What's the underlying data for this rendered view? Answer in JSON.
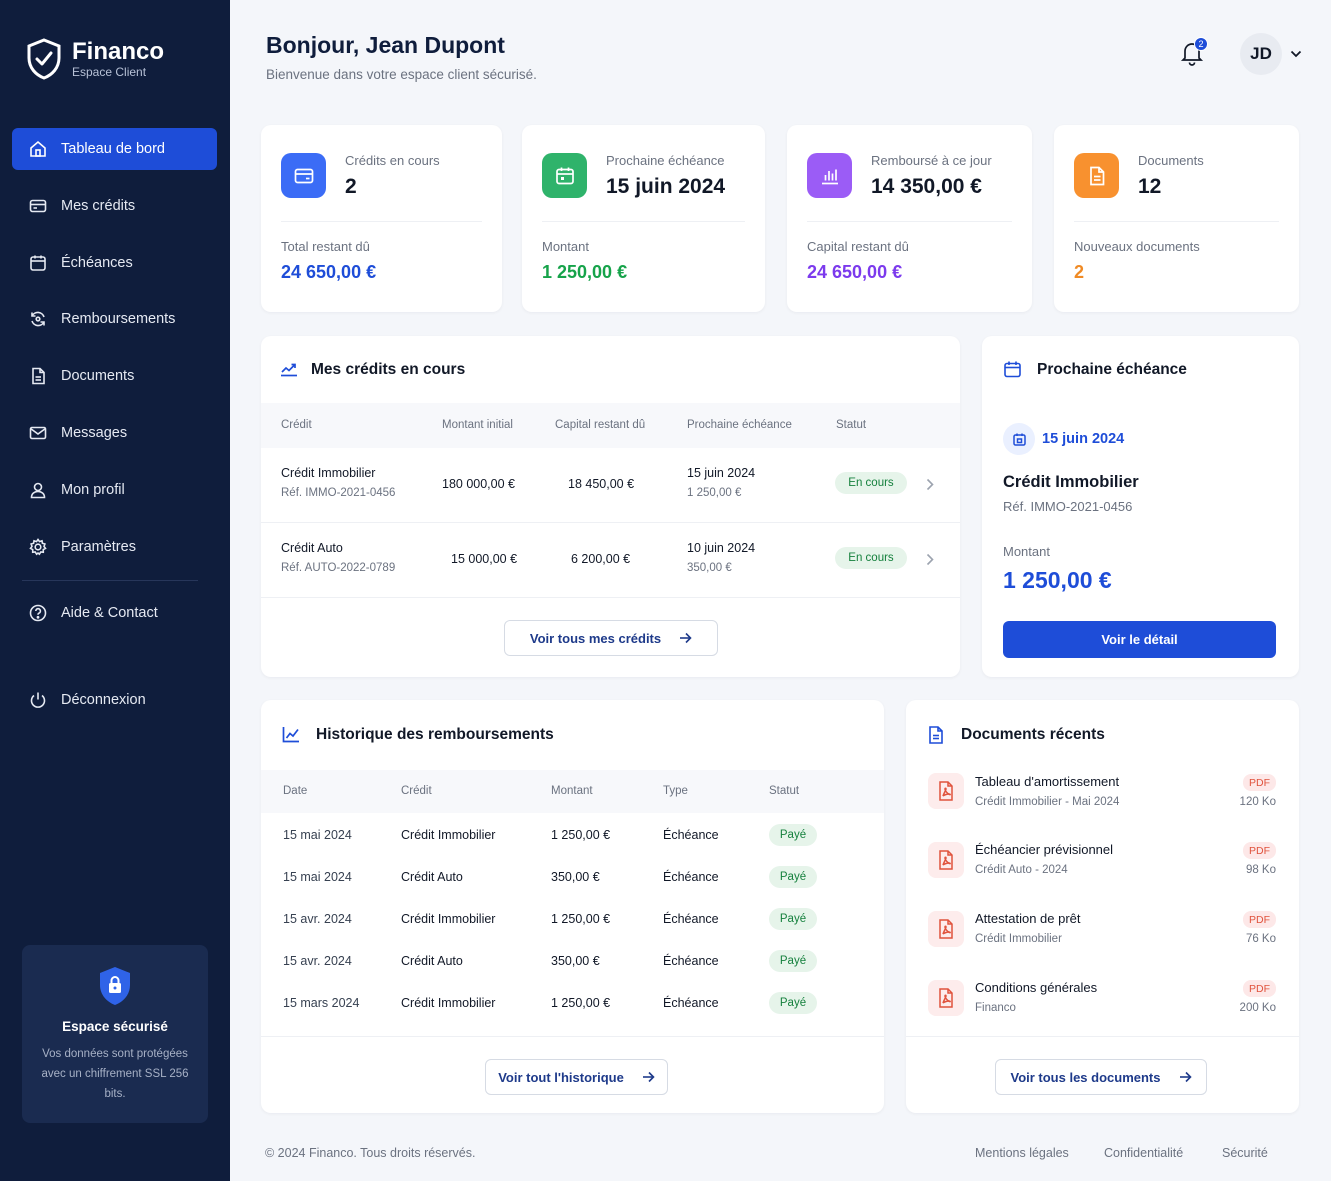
{
  "brand": {
    "name": "Financo",
    "subtitle": "Espace Client"
  },
  "nav": [
    {
      "label": "Tableau de bord",
      "icon": "home-icon",
      "active": true
    },
    {
      "label": "Mes crédits",
      "icon": "card-icon"
    },
    {
      "label": "Échéances",
      "icon": "calendar-icon"
    },
    {
      "label": "Remboursements",
      "icon": "refresh-icon"
    },
    {
      "label": "Documents",
      "icon": "document-icon"
    },
    {
      "label": "Messages",
      "icon": "mail-icon"
    },
    {
      "label": "Mon profil",
      "icon": "user-icon"
    },
    {
      "label": "Paramètres",
      "icon": "gear-icon"
    }
  ],
  "nav_help": "Aide & Contact",
  "nav_logout": "Déconnexion",
  "secure": {
    "title": "Espace sécurisé",
    "text": "Vos données sont protégées avec un chiffrement SSL 256 bits."
  },
  "header": {
    "greeting": "Bonjour, Jean Dupont",
    "subtitle": "Bienvenue dans votre espace client sécurisé.",
    "notifications": "2",
    "initials": "JD"
  },
  "stats": [
    {
      "label": "Crédits en cours",
      "value": "2",
      "label2": "Total restant dû",
      "value2": "24 650,00 €",
      "accent": "#3b6cf6",
      "value2_color": "#1e4dd8"
    },
    {
      "label": "Prochaine échéance",
      "value": "15 juin 2024",
      "label2": "Montant",
      "value2": "1 250,00 €",
      "accent": "#2fb36b",
      "value2_color": "#16a34a"
    },
    {
      "label": "Remboursé à ce jour",
      "value": "14 350,00 €",
      "label2": "Capital restant dû",
      "value2": "24 650,00 €",
      "accent": "#9b5cf6",
      "value2_color": "#7c3aed"
    },
    {
      "label": "Documents",
      "value": "12",
      "label2": "Nouveaux documents",
      "value2": "2",
      "accent": "#f8912f",
      "value2_color": "#f08a24"
    }
  ],
  "credits": {
    "title": "Mes crédits en cours",
    "headers": [
      "Crédit",
      "Montant initial",
      "Capital restant dû",
      "Prochaine échéance",
      "Statut"
    ],
    "rows": [
      {
        "name": "Crédit Immobilier",
        "ref": "Réf. IMMO-2021-0456",
        "initial": "180 000,00 €",
        "remaining": "18 450,00 €",
        "date": "15 juin 2024",
        "amount": "1 250,00 €",
        "status": "En cours"
      },
      {
        "name": "Crédit Auto",
        "ref": "Réf. AUTO-2022-0789",
        "initial": "15 000,00 €",
        "remaining": "6 200,00 €",
        "date": "10 juin 2024",
        "amount": "350,00 €",
        "status": "En cours"
      }
    ],
    "button": "Voir tous mes crédits"
  },
  "next": {
    "title": "Prochaine échéance",
    "date": "15 juin 2024",
    "credit": "Crédit Immobilier",
    "ref": "Réf. IMMO-2021-0456",
    "amount_label": "Montant",
    "amount": "1 250,00 €",
    "button": "Voir le détail"
  },
  "history": {
    "title": "Historique des remboursements",
    "headers": [
      "Date",
      "Crédit",
      "Montant",
      "Type",
      "Statut"
    ],
    "rows": [
      {
        "date": "15 mai 2024",
        "credit": "Crédit Immobilier",
        "amount": "1 250,00 €",
        "type": "Échéance",
        "status": "Payé"
      },
      {
        "date": "15 mai 2024",
        "credit": "Crédit Auto",
        "amount": "350,00 €",
        "type": "Échéance",
        "status": "Payé"
      },
      {
        "date": "15 avr. 2024",
        "credit": "Crédit Immobilier",
        "amount": "1 250,00 €",
        "type": "Échéance",
        "status": "Payé"
      },
      {
        "date": "15 avr. 2024",
        "credit": "Crédit Auto",
        "amount": "350,00 €",
        "type": "Échéance",
        "status": "Payé"
      },
      {
        "date": "15 mars 2024",
        "credit": "Crédit Immobilier",
        "amount": "1 250,00 €",
        "type": "Échéance",
        "status": "Payé"
      }
    ],
    "button": "Voir tout l'historique"
  },
  "documents": {
    "title": "Documents récents",
    "items": [
      {
        "name": "Tableau d'amortissement",
        "sub": "Crédit Immobilier - Mai 2024",
        "type": "PDF",
        "size": "120 Ko"
      },
      {
        "name": "Échéancier prévisionnel",
        "sub": "Crédit Auto - 2024",
        "type": "PDF",
        "size": "98 Ko"
      },
      {
        "name": "Attestation de prêt",
        "sub": "Crédit Immobilier",
        "type": "PDF",
        "size": "76 Ko"
      },
      {
        "name": "Conditions générales",
        "sub": "Financo",
        "type": "PDF",
        "size": "200 Ko"
      }
    ],
    "button": "Voir tous les documents"
  },
  "footer": {
    "copyright": "© 2024 Financo. Tous droits réservés.",
    "links": [
      "Mentions légales",
      "Confidentialité",
      "Sécurité"
    ]
  }
}
